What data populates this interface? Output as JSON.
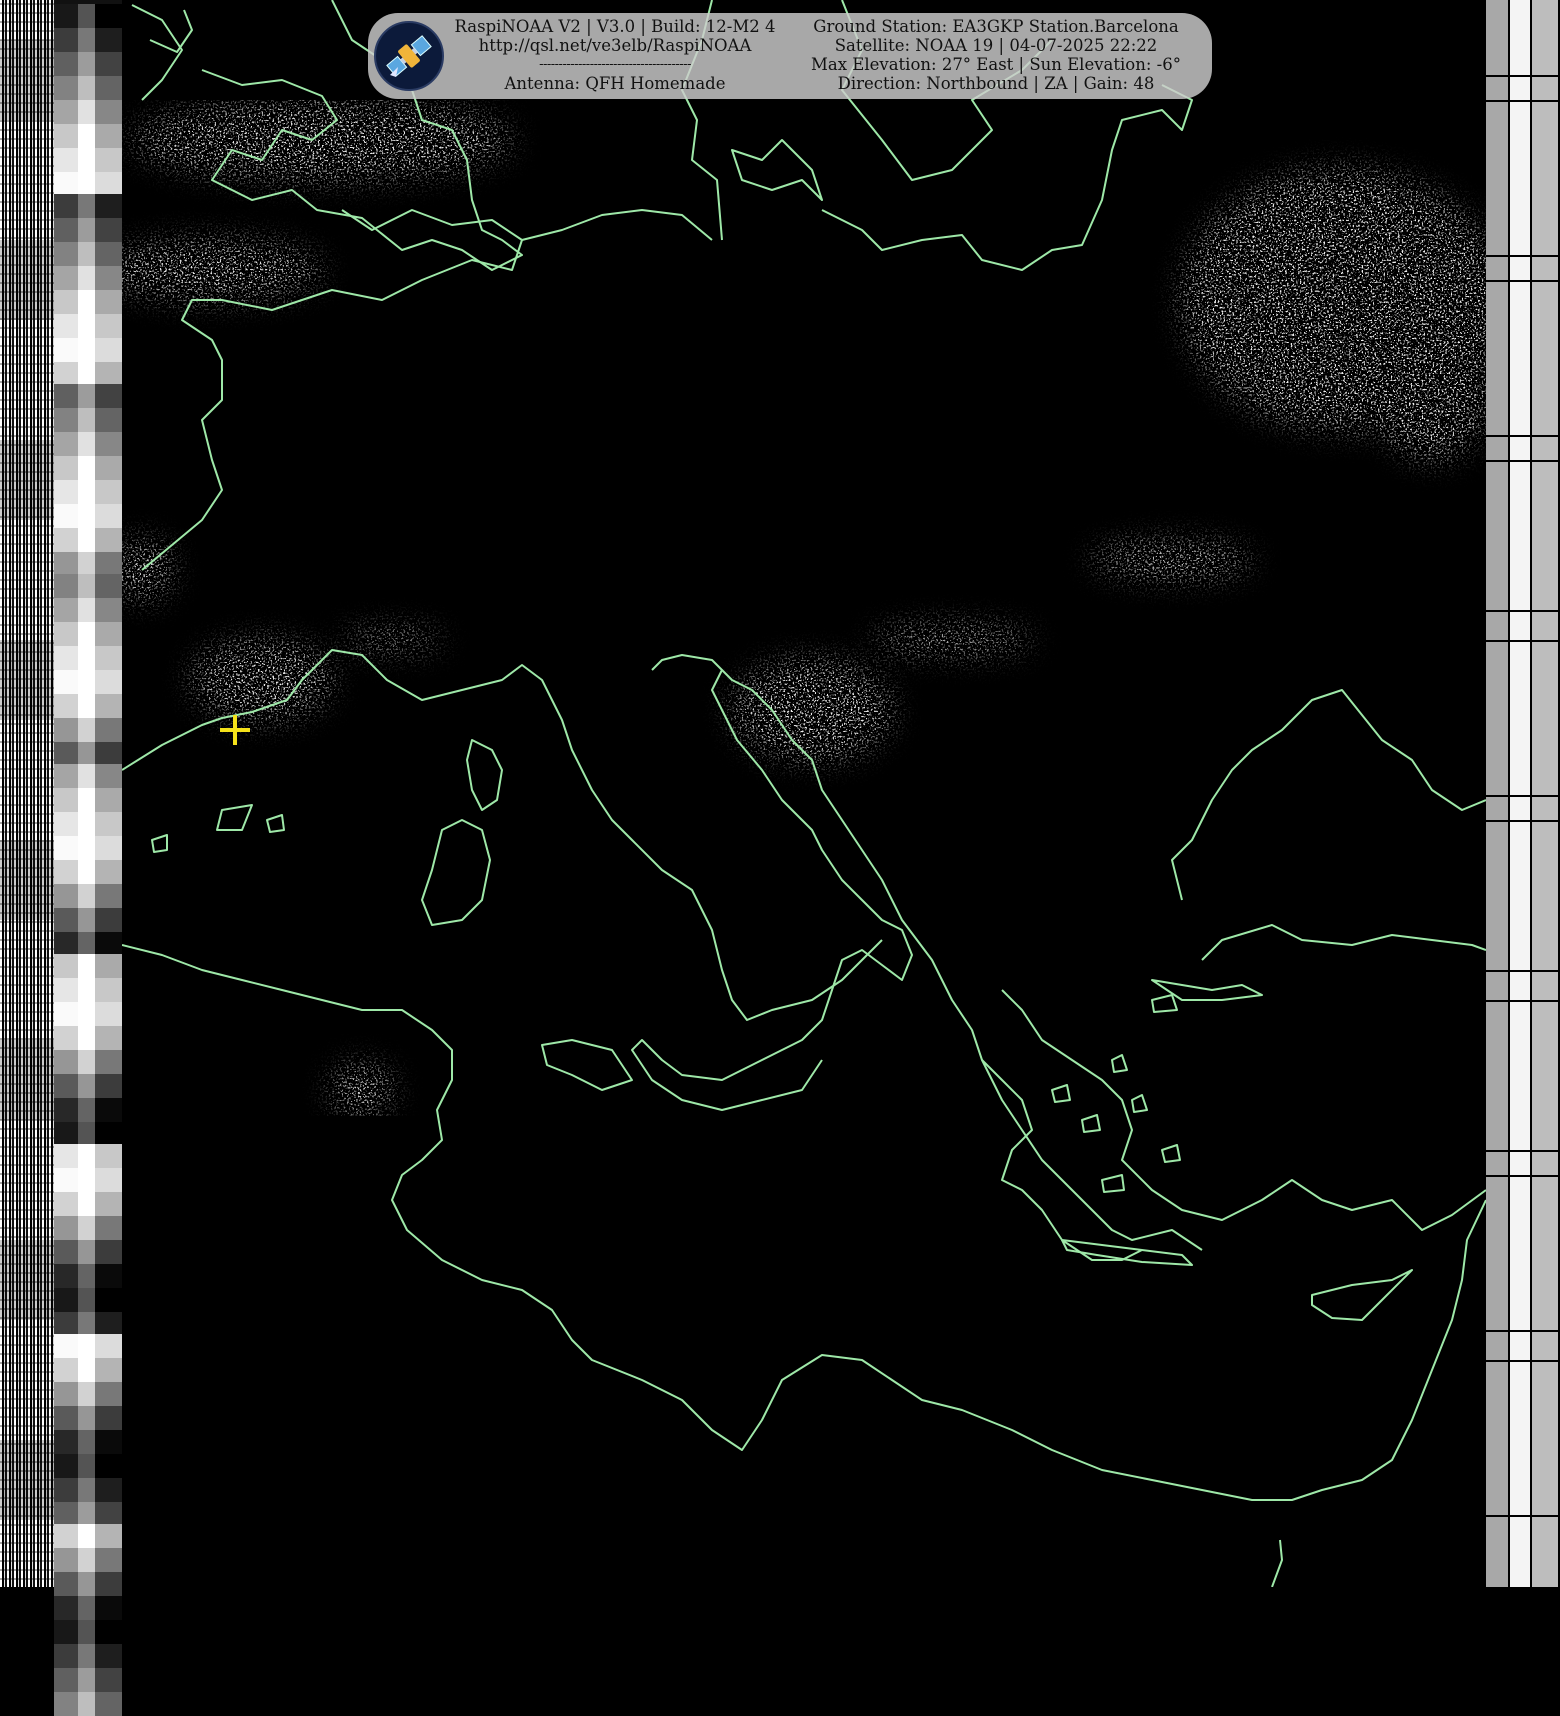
{
  "overlay": {
    "left_lines": [
      "RaspiNOAA V2 | V3.0 | Build: 12-M2 4",
      "http://qsl.net/ve3elb/RaspiNOAA",
      "---------------------------------------",
      "Antenna: QFH Homemade"
    ],
    "right_lines": [
      "Ground Station: EA3GKP Station.Barcelona",
      "Satellite: NOAA 19 | 04-07-2025 22:22",
      "Max Elevation: 27° East | Sun Elevation: -6°",
      "Direction: Northbound | ZA | Gain: 48"
    ]
  },
  "logo": {
    "icon": "satellite-icon",
    "background": "#0c1a3a"
  },
  "ground_station_marker": {
    "icon": "plus-marker-icon",
    "color": "#f5e21a"
  },
  "map": {
    "coastline_color": "#9ee8a8",
    "background": "#000000",
    "cloud_color": "#d8d8d8"
  }
}
